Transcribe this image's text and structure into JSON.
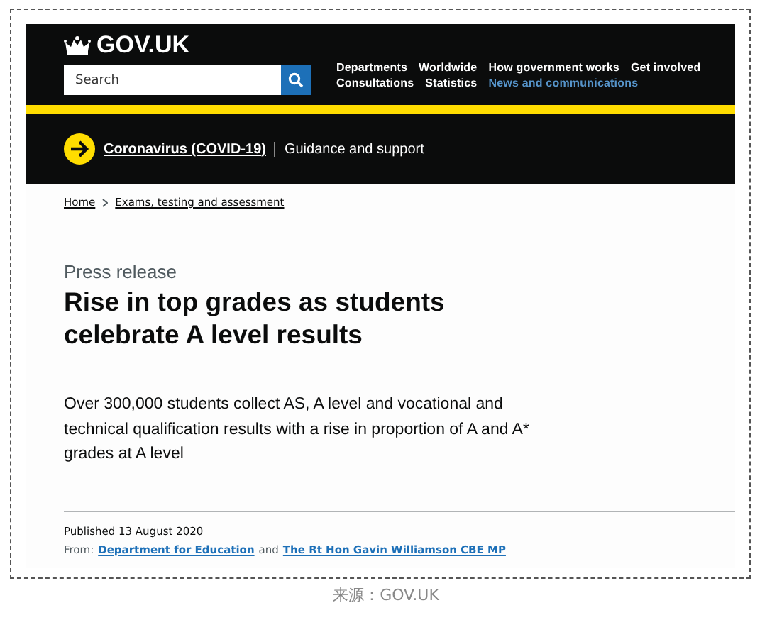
{
  "header": {
    "logo": "GOV.UK",
    "search": {
      "placeholder": "Search"
    },
    "nav": [
      {
        "label": "Departments",
        "selected": false
      },
      {
        "label": "Worldwide",
        "selected": false
      },
      {
        "label": "How government works",
        "selected": false
      },
      {
        "label": "Get involved",
        "selected": false
      },
      {
        "label": "Consultations",
        "selected": false
      },
      {
        "label": "Statistics",
        "selected": false
      },
      {
        "label": "News and communications",
        "selected": true
      }
    ]
  },
  "banner": {
    "link": "Coronavirus (COVID-19)",
    "text": "Guidance and support"
  },
  "breadcrumbs": [
    "Home",
    "Exams, testing and assessment"
  ],
  "article": {
    "type": "Press release",
    "title": "Rise in top grades as students celebrate A level results",
    "summary": "Over 300,000 students collect AS, A level and vocational and technical qualification results with a rise in proportion of A and A* grades at A level",
    "published": "Published 13 August 2020",
    "from_label": "From:",
    "from": [
      "Department for Education",
      "The Rt Hon Gavin Williamson CBE MP"
    ],
    "joiner": "and"
  },
  "caption": "来源：GOV.UK"
}
